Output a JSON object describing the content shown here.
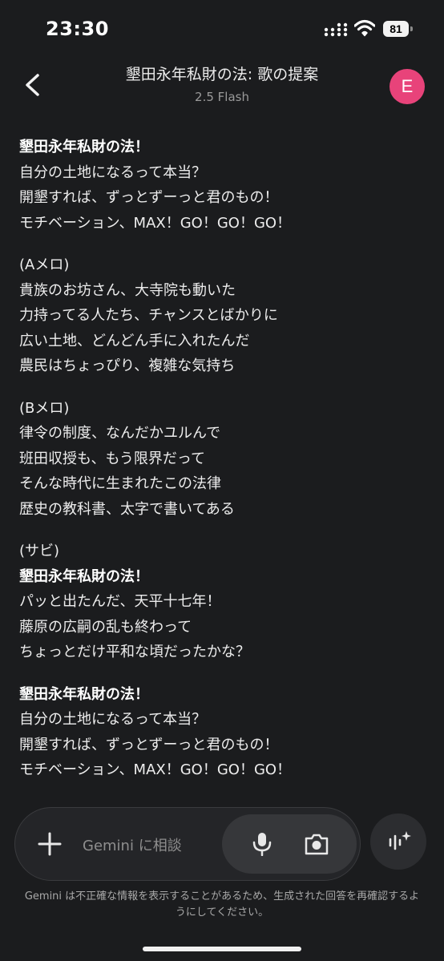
{
  "status_bar": {
    "time": "23:30",
    "battery": "81"
  },
  "header": {
    "title": "墾田永年私財の法: 歌の提案",
    "subtitle": "2.5 Flash",
    "avatar_letter": "E",
    "avatar_color": "#e8437a"
  },
  "content": {
    "stanzas": [
      {
        "lines": [
          {
            "text": "墾田永年私財の法！",
            "bold": true
          },
          {
            "text": "自分の土地になるって本当？",
            "bold": false
          },
          {
            "text": "開墾すれば、ずっとずーっと君のもの！",
            "bold": false
          },
          {
            "text": "モチベーション、MAX！GO！GO！GO！",
            "bold": false
          }
        ]
      },
      {
        "lines": [
          {
            "text": "(Aメロ)",
            "bold": false
          },
          {
            "text": "貴族のお坊さん、大寺院も動いた",
            "bold": false
          },
          {
            "text": "力持ってる人たち、チャンスとばかりに",
            "bold": false
          },
          {
            "text": "広い土地、どんどん手に入れたんだ",
            "bold": false
          },
          {
            "text": "農民はちょっぴり、複雑な気持ち",
            "bold": false
          }
        ]
      },
      {
        "lines": [
          {
            "text": "(Bメロ)",
            "bold": false
          },
          {
            "text": "律令の制度、なんだかユルんで",
            "bold": false
          },
          {
            "text": "班田収授も、もう限界だって",
            "bold": false
          },
          {
            "text": "そんな時代に生まれたこの法律",
            "bold": false
          },
          {
            "text": "歴史の教科書、太字で書いてある",
            "bold": false
          }
        ]
      },
      {
        "lines": [
          {
            "text": "(サビ)",
            "bold": false
          },
          {
            "text": "墾田永年私財の法！",
            "bold": true
          },
          {
            "text": "パッと出たんだ、天平十七年！",
            "bold": false
          },
          {
            "text": "藤原の広嗣の乱も終わって",
            "bold": false
          },
          {
            "text": "ちょっとだけ平和な頃だったかな？",
            "bold": false
          }
        ]
      },
      {
        "lines": [
          {
            "text": "墾田永年私財の法！",
            "bold": true
          },
          {
            "text": "自分の土地になるって本当？",
            "bold": false
          },
          {
            "text": "開墾すれば、ずっとずーっと君のもの！",
            "bold": false
          },
          {
            "text": "モチベーション、MAX！GO！GO！GO！",
            "bold": false
          }
        ]
      }
    ]
  },
  "input": {
    "placeholder": "Gemini に相談"
  },
  "icons": {
    "back": "chevron-left-icon",
    "plus": "plus-icon",
    "mic": "microphone-icon",
    "camera": "camera-icon",
    "voice": "sparkle-waveform-icon"
  },
  "disclaimer": "Gemini は不正確な情報を表示することがあるため、生成された回答を再確認するようにしてください。"
}
